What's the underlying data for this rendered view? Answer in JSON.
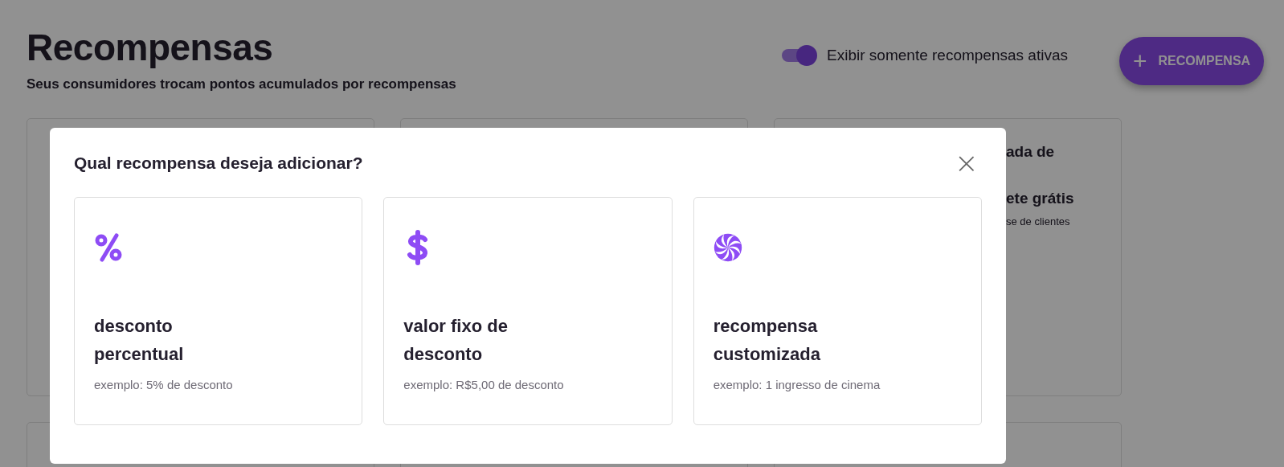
{
  "page": {
    "title": "Recompensas",
    "subtitle": "Seus consumidores trocam pontos acumulados por recompensas",
    "toggle": {
      "label": "Exibir somente recompensas ativas",
      "on": true
    },
    "add_button": {
      "icon": "+",
      "label": "RECOMPENSA"
    },
    "third_card_lines": [
      {
        "kind": "title",
        "text": "ada de"
      },
      {
        "kind": "title",
        "text": "ete grátis"
      },
      {
        "kind": "note",
        "text": "se de clientes"
      }
    ]
  },
  "modal": {
    "title": "Qual recompensa deseja adicionar?",
    "close": "×",
    "options": [
      {
        "kind": "percent",
        "title": "desconto percentual",
        "example": "exemplo: 5% de desconto"
      },
      {
        "kind": "dollar",
        "title": "valor fixo de desconto",
        "example": "exemplo: R$5,00 de desconto"
      },
      {
        "kind": "swirl",
        "title": "recompensa customizada",
        "example": "exemplo: 1 ingresso de cinema"
      }
    ]
  }
}
